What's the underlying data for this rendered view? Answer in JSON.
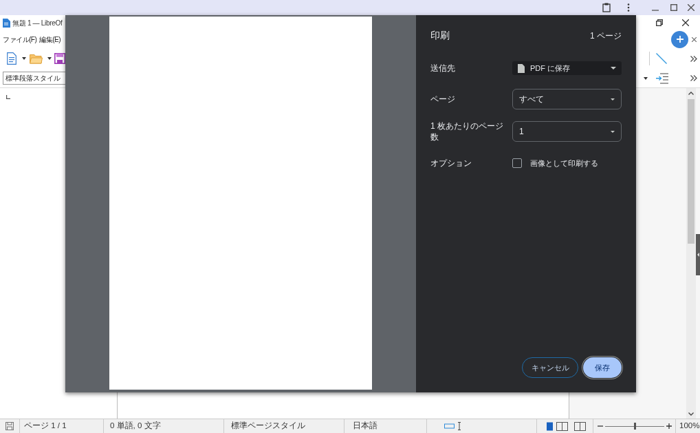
{
  "window": {
    "title": "無題 1 — LibreOf",
    "menu": [
      "ファイル(F)",
      "編集(E)"
    ],
    "paragraph_style": "標準段落スタイル"
  },
  "print_dialog": {
    "title": "印刷",
    "page_count": "1 ページ",
    "settings": [
      {
        "kind": "destination",
        "label": "送信先",
        "value": "PDF に保存"
      },
      {
        "kind": "select",
        "label": "ページ",
        "value": "すべて"
      },
      {
        "kind": "select",
        "label": "1 枚あたりのページ数",
        "value": "1"
      },
      {
        "kind": "checkbox",
        "label": "オプション",
        "option": "画像として印刷する",
        "checked": false
      }
    ],
    "buttons": [
      {
        "kind": "secondary",
        "label": "キャンセル"
      },
      {
        "kind": "primary",
        "label": "保存"
      }
    ]
  },
  "status_bar": {
    "page": "ページ 1 / 1",
    "word_count": "0 単語, 0 文字",
    "page_style": "標準ページスタイル",
    "language": "日本語",
    "zoom_slider": {
      "level": 0.5
    },
    "zoom": "100%"
  }
}
